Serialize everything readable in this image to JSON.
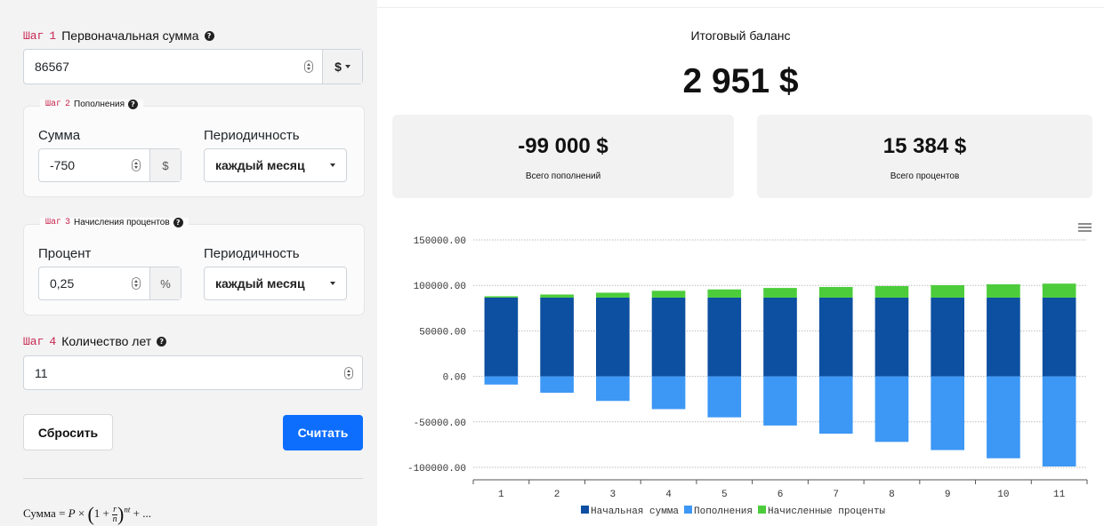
{
  "form": {
    "step_word": "Шаг",
    "step1": {
      "num": "1",
      "title": "Первоначальная сумма",
      "value": "86567",
      "currency": "$"
    },
    "step2": {
      "num": "2",
      "title": "Пополнения",
      "amount_label": "Сумма",
      "amount_value": "-750",
      "amount_unit": "$",
      "period_label": "Периодичность",
      "period_value": "каждый месяц"
    },
    "step3": {
      "num": "3",
      "title": "Начисления процентов",
      "rate_label": "Процент",
      "rate_value": "0,25",
      "rate_unit": "%",
      "period_label": "Периодичность",
      "period_value": "каждый месяц"
    },
    "step4": {
      "num": "4",
      "title": "Количество лет",
      "value": "11"
    },
    "reset_label": "Сбросить",
    "calc_label": "Считать",
    "formula": {
      "lhs": "Сумма",
      "tail": "+ ..."
    }
  },
  "summary": {
    "balance_title": "Итоговый баланс",
    "balance_value": "2 951 $",
    "cards": [
      {
        "value": "-99 000 $",
        "label": "Всего пополнений"
      },
      {
        "value": "15 384 $",
        "label": "Всего процентов"
      }
    ]
  },
  "colors": {
    "initial": "#0d4fa0",
    "deposits": "#3d97f5",
    "interest": "#4ccc3b",
    "accent": "#0d6efd",
    "step": "#c7254e"
  },
  "chart_data": {
    "type": "bar",
    "stacked": true,
    "categories": [
      "1",
      "2",
      "3",
      "4",
      "5",
      "6",
      "7",
      "8",
      "9",
      "10",
      "11"
    ],
    "series": [
      {
        "name": "Начальная сумма",
        "color": "#0d4fa0",
        "values": [
          86567,
          86567,
          86567,
          86567,
          86567,
          86567,
          86567,
          86567,
          86567,
          86567,
          86567
        ]
      },
      {
        "name": "Пополнения",
        "color": "#3d97f5",
        "values": [
          -9000,
          -18000,
          -27000,
          -36000,
          -45000,
          -54000,
          -63000,
          -72000,
          -81000,
          -90000,
          -99000
        ]
      },
      {
        "name": "Начисленные проценты",
        "color": "#4ccc3b",
        "values": [
          1500,
          3400,
          5400,
          7500,
          9000,
          10600,
          11700,
          12700,
          13700,
          14600,
          15384
        ]
      }
    ],
    "y_ticks": [
      "150000.00",
      "100000.00",
      "50000.00",
      "0.00",
      "-50000.00",
      "-100000.00"
    ],
    "ylim": [
      -100000,
      150000
    ],
    "grid": true,
    "legend_position": "bottom"
  }
}
